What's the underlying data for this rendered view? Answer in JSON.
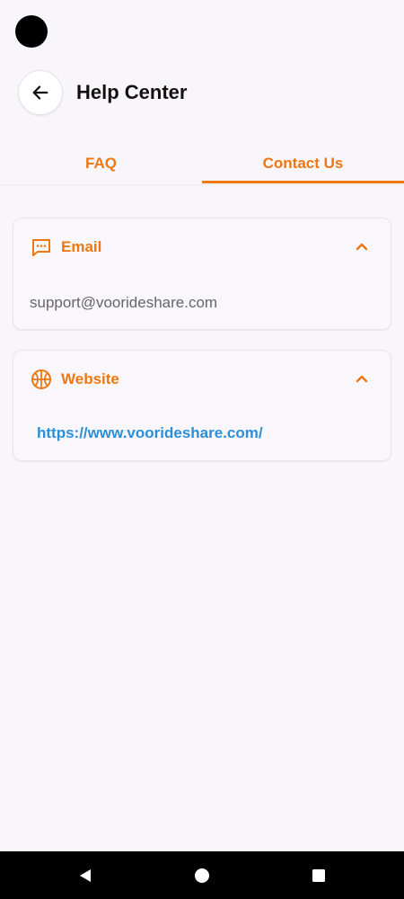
{
  "header": {
    "title": "Help Center"
  },
  "tabs": [
    {
      "label": "FAQ",
      "selected": false
    },
    {
      "label": "Contact Us",
      "selected": true
    }
  ],
  "contact": {
    "email": {
      "title": "Email",
      "value": "support@voorideshare.com",
      "icon": "message-icon",
      "expanded": true
    },
    "website": {
      "title": "Website",
      "value": "https://www.voorideshare.com/",
      "icon": "globe-icon",
      "expanded": true
    }
  },
  "colors": {
    "accent": "#ee7711",
    "link": "#2a8fd6",
    "background": "#f8f6fa"
  }
}
